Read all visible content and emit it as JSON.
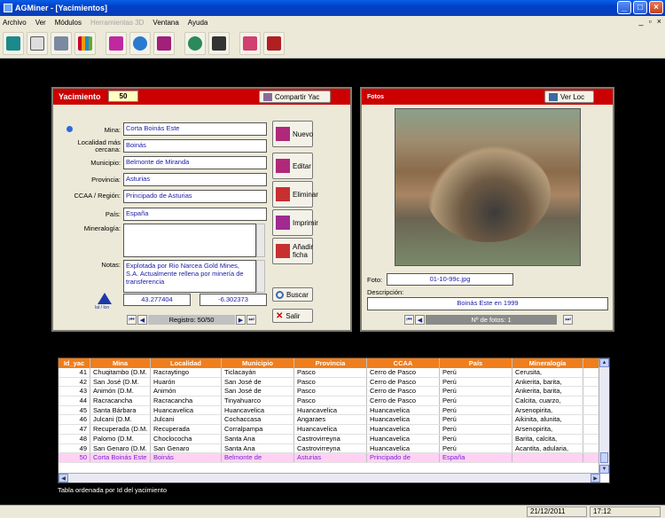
{
  "window": {
    "title": "AGMiner - [Yacimientos]"
  },
  "menu": {
    "items": [
      "Archivo",
      "Ver",
      "Módulos",
      "Herramientas 3D",
      "Ventana",
      "Ayuda"
    ]
  },
  "toolbar": {
    "icons": [
      "mining-tool-icon",
      "cube-icon",
      "factory-icon",
      "bar-chart-icon",
      "book-icon",
      "globe-icon",
      "document-icon",
      "headset-icon",
      "binoculars-icon",
      "pdf-icon",
      "stamp-icon"
    ]
  },
  "left_panel": {
    "title": "Yacimiento",
    "id_value": "50",
    "share_label": "Compartir Yac",
    "labels": {
      "mina": "Mina:",
      "localidad": "Localidad más cercana:",
      "municipio": "Municipio:",
      "provincia": "Provincia:",
      "ccaa": "CCAA / Región:",
      "pais": "País:",
      "mineralogia": "Mineralogía:",
      "notas": "Notas:"
    },
    "values": {
      "mina": "Corta Boinás Este",
      "localidad": "Boinás",
      "municipio": "Belmonte de Miranda",
      "provincia": "Asturias",
      "ccaa": "Principado de Asturias",
      "pais": "España",
      "mineralogia": "",
      "notas": "Explotada por Rio Narcea Gold Mines, S.A. Actualmente rellena por minería de transferencia"
    },
    "lat": "43.277404",
    "lon": "-6.302373",
    "latlon_label": "lat / lon",
    "buttons": {
      "nuevo": "Nuevo",
      "editar": "Editar",
      "eliminar": "Eliminar",
      "imprimir": "Imprimir",
      "anadir": "Añadir ficha",
      "buscar": "Buscar",
      "salir": "Salir"
    },
    "record_text": "Registro: 50/50"
  },
  "right_panel": {
    "title": "Fotos",
    "ver_loc_label": "Ver Loc",
    "foto_label": "Foto:",
    "foto_value": "01-10-99c.jpg",
    "descripcion_label": "Descripción:",
    "descripcion_value": "Boinás Este en 1999",
    "photo_count_text": "Nº de fotos: 1"
  },
  "table": {
    "columns": [
      "Id_yac",
      "Mina",
      "Localidad",
      "Municipio",
      "Provincia",
      "CCAA",
      "País",
      "Mineralogía"
    ],
    "rows": [
      [
        "41",
        "Chuqitambo (D.M.",
        "Racraytingo",
        "Ticlacayán",
        "Pasco",
        "Cerro de Pasco",
        "Perú",
        "Cerusita,"
      ],
      [
        "42",
        "San José  (D.M.",
        "Huarón",
        "San José de",
        "Pasco",
        "Cerro de Pasco",
        "Perú",
        "Ankerita, barita,"
      ],
      [
        "43",
        "Animón (D.M.",
        "Animón",
        "San José de",
        "Pasco",
        "Cerro de Pasco",
        "Perú",
        "Ankerita, barita,"
      ],
      [
        "44",
        "Racracancha",
        "Racracancha",
        "Tinyahuarco",
        "Pasco",
        "Cerro de Pasco",
        "Perú",
        "Calcita, cuarzo,"
      ],
      [
        "45",
        "Santa Bárbara",
        "Huancavelica",
        "Huancavelica",
        "Huancavelica",
        "Huancavelica",
        "Perú",
        "Arsenopirita,"
      ],
      [
        "46",
        "Julcani (D.M.",
        "Julcani",
        "Cochaccasa",
        "Angaraes",
        "Huancavelica",
        "Perú",
        "Aikinita, alunita,"
      ],
      [
        "47",
        "Recuperada (D.M.",
        "Recuperada",
        "Corralpampa",
        "Huancavelica",
        "Huancavelica",
        "Perú",
        "Arsenopirita,"
      ],
      [
        "48",
        "Palomo (D.M.",
        "Choclococha",
        "Santa Ana",
        "Castrovirreyna",
        "Huancavelica",
        "Perú",
        "Barita, calcita,"
      ],
      [
        "49",
        "San Genaro (D.M.",
        "San Genaro",
        "Santa Ana",
        "Castrovirreyna",
        "Huancavelica",
        "Perú",
        "Acantita, adularia,"
      ],
      [
        "50",
        "Corta Boinás Este",
        "Boinás",
        "Belmonte de",
        "Asturias",
        "Principado de",
        "España",
        ""
      ]
    ],
    "selected_index": 9,
    "footnote": "Tabla ordenada por Id del yacimiento"
  },
  "status": {
    "date": "21/12/2011",
    "time": "17:12"
  }
}
